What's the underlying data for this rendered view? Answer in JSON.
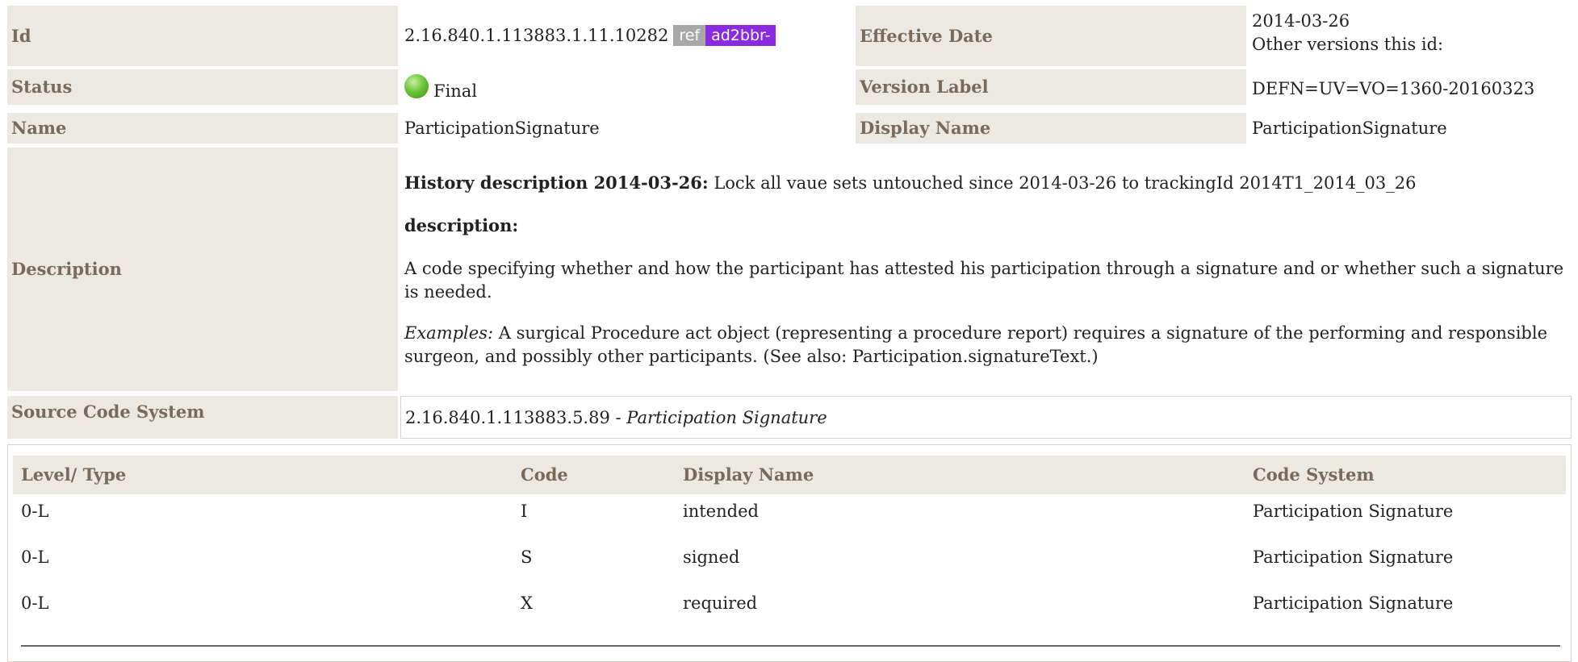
{
  "labels": {
    "id": "Id",
    "effective_date": "Effective Date",
    "status": "Status",
    "version_label": "Version Label",
    "name": "Name",
    "display_name": "Display Name",
    "description": "Description",
    "source_code_system": "Source Code System"
  },
  "values": {
    "id": "2.16.840.1.113883.1.11.10282",
    "ref_badge": "ref",
    "prefix_badge": "ad2bbr-",
    "effective_date": "2014-03-26",
    "other_versions": "Other versions this id:",
    "status": "Final",
    "version_label": "DEFN=UV=VO=1360-20160323",
    "name": "ParticipationSignature",
    "display_name": "ParticipationSignature"
  },
  "description": {
    "history_label": "History description 2014-03-26:",
    "history_text": " Lock all vaue sets untouched since 2014-03-26 to trackingId 2014T1_2014_03_26",
    "desc_label": "description:",
    "desc_text": "A code specifying whether and how the participant has attested his participation through a signature and or whether such a signature is needed.",
    "examples_label": "Examples:",
    "examples_text": " A surgical Procedure act object (representing a procedure report) requires a signature of the performing and responsible surgeon, and possibly other participants. (See also: Participation.signatureText.)"
  },
  "source": {
    "oid": "2.16.840.1.113883.5.89",
    "separator": " - ",
    "name": "Participation Signature"
  },
  "table": {
    "headers": [
      "Level/ Type",
      "Code",
      "Display Name",
      "Code System"
    ],
    "rows": [
      [
        "0-L",
        "I",
        "intended",
        "Participation Signature"
      ],
      [
        "0-L",
        "S",
        "signed",
        "Participation Signature"
      ],
      [
        "0-L",
        "X",
        "required",
        "Participation Signature"
      ]
    ]
  },
  "colors": {
    "label_bg": "#ece8e2",
    "label_text": "#7a6a5a",
    "status_final": "#5cb82e",
    "prefix_badge": "#8a2be2",
    "ref_badge": "#a8a8a8"
  }
}
